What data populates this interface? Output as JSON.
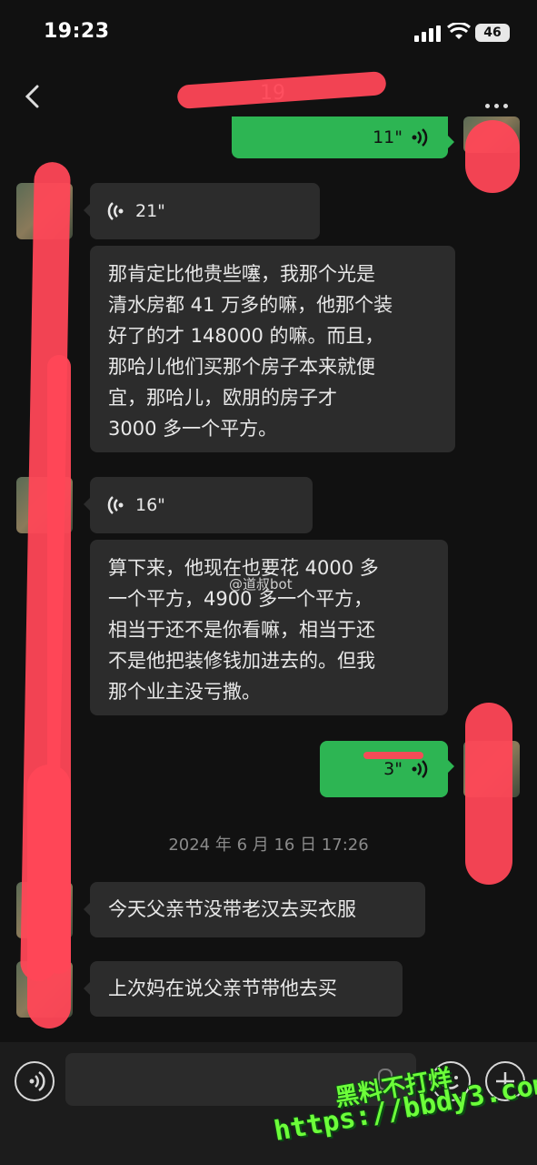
{
  "status_bar": {
    "time": "19:23",
    "battery": "46"
  },
  "header": {
    "title": "19",
    "back_icon": "chevron-left-icon",
    "more_icon": "more-dots-icon"
  },
  "messages": {
    "m1": {
      "duration": "11\""
    },
    "m2": {
      "duration": "21\""
    },
    "m3": {
      "lines": [
        "那肯定比他贵些噻，我那个光是",
        "清水房都 41 万多的嘛，他那个装",
        "好了的才 148000 的嘛。而且，",
        "那哈儿他们买那个房子本来就便",
        "宜，那哈儿，欧朋的房子才",
        "3000 多一个平方。"
      ]
    },
    "m4": {
      "duration": "16\""
    },
    "m5": {
      "lines": [
        "算下来，他现在也要花 4000 多",
        "一个平方，4900 多一个平方，",
        "相当于还不是你看嘛，相当于还",
        "不是他把装修钱加进去的。但我",
        "那个业主没亏撒。"
      ]
    },
    "m6": {
      "duration": "3\""
    },
    "timestamp": "2024 年 6 月 16 日 17:26",
    "m7": {
      "text": "今天父亲节没带老汉去买衣服"
    },
    "m8": {
      "text": "上次妈在说父亲节带他去买"
    }
  },
  "watermark": "@道叔bot",
  "promo": {
    "line1": "黑料不打烊",
    "line2": "https://bbdy3.com"
  },
  "colors": {
    "background": "#111111",
    "bubble_incoming": "#2c2c2c",
    "bubble_outgoing": "#2db553",
    "redaction": "#ff4757",
    "promo": "#6dff3a"
  }
}
